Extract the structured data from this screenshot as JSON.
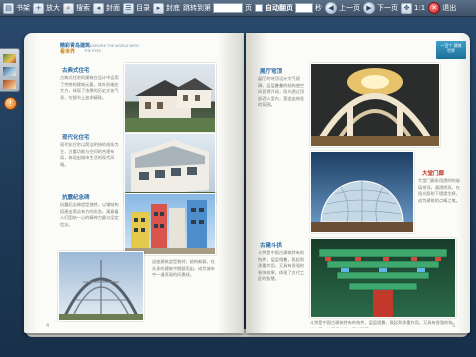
{
  "toolbar": {
    "bookshelf_label": "书架",
    "zoom_in_label": "放大",
    "search_label": "搜索",
    "cover_label": "封面",
    "contents_label": "目录",
    "back_cover_label": "封底",
    "goto_label": "跳转到第",
    "goto_value": "",
    "page_unit": "页",
    "autoflip_label": "自动翻页",
    "autoflip_seconds": "",
    "seconds_unit": "秒",
    "prev_label": "上一页",
    "next_label": "下一页",
    "ratio_label": "1:1",
    "exit_label": "退出"
  },
  "left_page": {
    "header_cn": "精彩青岛建筑",
    "header_sub": "看世界",
    "header_en": "TO EXPLORE THE WORLD WITH THE EYES",
    "sections": [
      {
        "title": "古典式住宅",
        "body": "古典式住宅的建筑在设计中运用了传统的建筑元素，其外形端庄大方，体现了浓厚的历史文化气息，在细节上追求精致。"
      },
      {
        "title": "现代化住宅",
        "body": "现代化住宅以简洁明快的线条为主，注重功能与空间的合理布局，体现出城市生活的现代风格。"
      },
      {
        "title": "抗震纪念碑",
        "body": "抗震纪念碑造型独特，以钢结构搭建出简洁有力的形态，寓意着人们团结一心的精神力量与坚定信念。"
      }
    ],
    "caption": "这座建筑造型独特，结构新颖，在众多的建筑中脱颖而出，成为城市中一道亮丽的风景线。",
    "page_number": "4"
  },
  "right_page": {
    "badge_text": "一百个 建筑 世界",
    "sections": [
      {
        "title": "展厅穹顶",
        "body": "展厅的穹顶设计大气磅礴，层层叠叠的结构使空间显得开阔，阳光透过顶部洒入室内，营造出神圣的氛围。"
      },
      {
        "title": "大堂门廊",
        "body": "大堂门廊采用透明的玻璃穹顶，通透明亮，在阳光照射下熠熠生辉，成为建筑的点睛之笔。"
      },
      {
        "title": "古建斗拱",
        "body": "斗拱是中国古建筑特有的构件，层层相叠，既起到承重作用，又具有很强的装饰效果，体现了古代工匠的智慧。"
      }
    ],
    "page_number": "5"
  }
}
